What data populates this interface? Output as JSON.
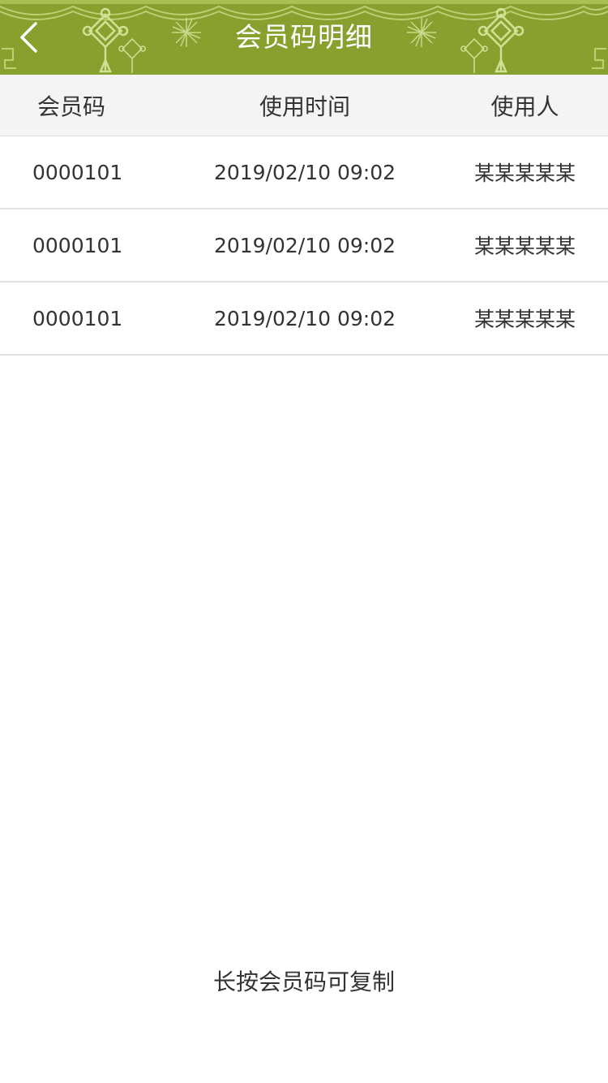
{
  "header": {
    "title": "会员码明细",
    "background_color": "#87a02e",
    "back_icon": "chevron-left-icon"
  },
  "table": {
    "columns": [
      "会员码",
      "使用时间",
      "使用人"
    ],
    "rows": [
      {
        "code": "0000101",
        "time": "2019/02/10 09:02",
        "user": "某某某某某"
      },
      {
        "code": "0000101",
        "time": "2019/02/10 09:02",
        "user": "某某某某某"
      },
      {
        "code": "0000101",
        "time": "2019/02/10 09:02",
        "user": "某某某某某"
      }
    ]
  },
  "hint": "长按会员码可复制"
}
